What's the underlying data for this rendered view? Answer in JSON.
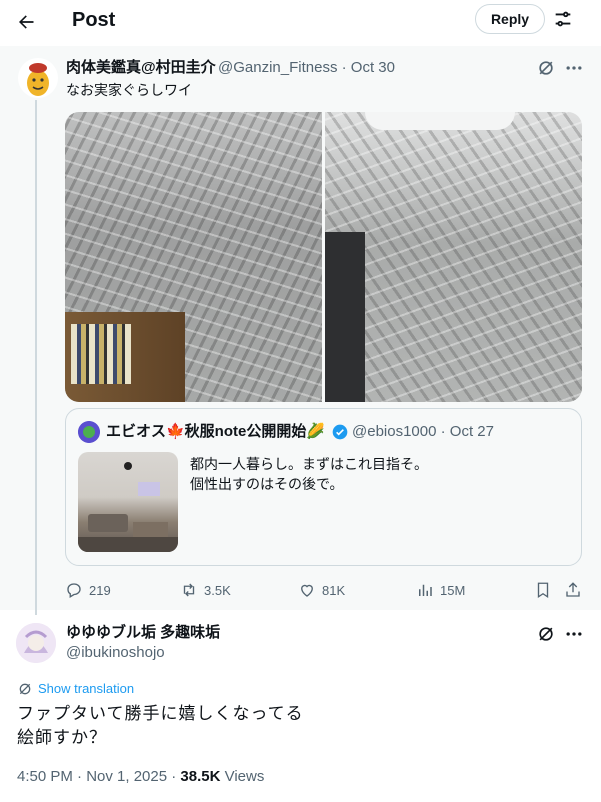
{
  "header": {
    "title": "Post",
    "reply_label": "Reply"
  },
  "parent": {
    "author_name": "肉体美鑑真@村田圭介",
    "author_handle": "@Ganzin_Fitness · Oct 30",
    "text": "なお実家ぐらしワイ",
    "quote": {
      "author_name": "エビオス🍁秋服note公開開始🌽",
      "author_handle": "@ebios1000 · Oct 27",
      "text_line1": "都内一人暮らし。まずはこれ目指そ。",
      "text_line2": "個性出すのはその後で。"
    },
    "stats": {
      "replies": "219",
      "reposts": "3.5K",
      "likes": "81K",
      "views": "15M"
    }
  },
  "reply": {
    "author_name": "ゆゆゆブル垢 多趣味垢",
    "author_handle": "@ibukinoshojo",
    "translate_label": "Show translation",
    "text_line1": "ファプタいて勝手に嬉しくなってる",
    "text_line2": "絵師すか？",
    "time_date": "4:50 PM · Nov 1, 2025 · ",
    "views_count": "38.5K",
    "views_label": " Views"
  },
  "colors": {
    "accent": "#1d9bf0",
    "muted": "#536471",
    "border": "#cfd9de",
    "verified": "#1d9bf0"
  },
  "icons": [
    "back-arrow-icon",
    "settings-icon",
    "grok-icon",
    "more-icon",
    "reply-icon",
    "repost-icon",
    "like-icon",
    "views-icon",
    "bookmark-icon",
    "share-icon",
    "verified-icon",
    "translate-icon"
  ]
}
